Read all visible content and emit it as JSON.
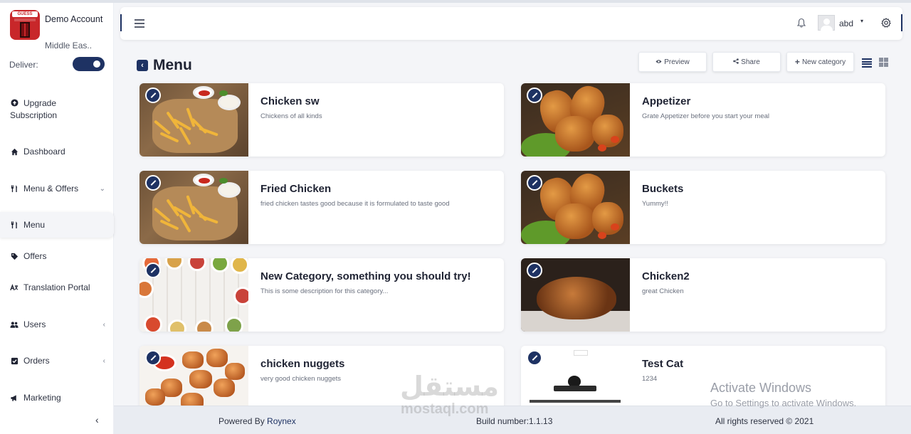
{
  "account": {
    "name": "Demo Account",
    "region": "Middle Eas..",
    "logo_text": "GUESS RESTAURANT"
  },
  "deliver": {
    "label": "Deliver:",
    "enabled": true
  },
  "sidebar": {
    "upgrade": {
      "label_line1": "Upgrade",
      "label_line2": "Subscription",
      "icon": "arrow-circle-up-icon"
    },
    "items": [
      {
        "label": "Dashboard",
        "icon": "home-icon"
      },
      {
        "label": "Menu & Offers",
        "icon": "cutlery-icon",
        "caret": "⌄"
      },
      {
        "label": "Menu",
        "icon": "cutlery-icon",
        "active": true
      },
      {
        "label": "Offers",
        "icon": "tag-icon"
      },
      {
        "label": "Translation Portal",
        "icon": "translate-icon"
      },
      {
        "label": "Users",
        "icon": "users-icon",
        "caret": "‹"
      },
      {
        "label": "Orders",
        "icon": "check-square-icon",
        "caret": "‹"
      },
      {
        "label": "Marketing",
        "icon": "megaphone-icon"
      }
    ],
    "collapse": "‹"
  },
  "header": {
    "username": "abd",
    "caret": "▾"
  },
  "page": {
    "title": "Menu",
    "back": "‹",
    "buttons": {
      "preview": "Preview",
      "share": "Share",
      "new_category": "New category"
    }
  },
  "categories": [
    {
      "title": "Chicken sw",
      "description": "Chickens of all kinds",
      "image": "fries"
    },
    {
      "title": "Appetizer",
      "description": "Grate Appetizer before you start your meal",
      "image": "fried-chicken"
    },
    {
      "title": "Fried Chicken",
      "description": "fried chicken tastes good because it is formulated to taste good",
      "image": "fries"
    },
    {
      "title": "Buckets",
      "description": "Yummy!!",
      "image": "fried-chicken"
    },
    {
      "title": "New Category, something you should try!",
      "description": "This is some description for this category...",
      "image": "table-spread"
    },
    {
      "title": "Chicken2",
      "description": "great Chicken",
      "image": "roast-chicken"
    },
    {
      "title": "chicken nuggets",
      "description": "very good chicken nuggets",
      "image": "nuggets"
    },
    {
      "title": "Test Cat",
      "description": "1234",
      "image": "dessert"
    }
  ],
  "footer": {
    "powered_prefix": "Powered By ",
    "powered_brand": "Roynex",
    "build": "Build number:1.1.13",
    "rights": "All rights reserved © 2021"
  },
  "overlay": {
    "activate_title": "Activate Windows",
    "activate_sub": "Go to Settings to activate Windows.",
    "watermark_ar": "مستقل",
    "watermark_en": "mostaql.com"
  },
  "colors": {
    "brand": "#1e3263",
    "logo_red": "#c8272a",
    "background": "#f4f5f8"
  }
}
